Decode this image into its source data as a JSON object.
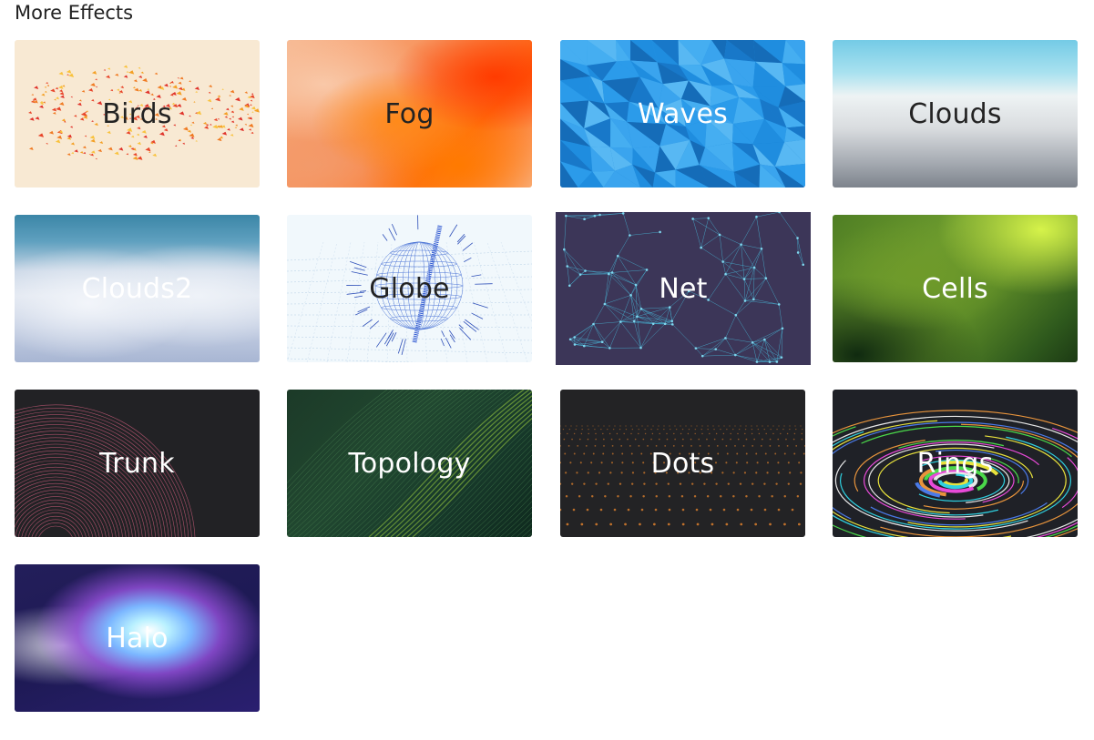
{
  "section_title": "More Effects",
  "effects": [
    {
      "label": "Birds"
    },
    {
      "label": "Fog"
    },
    {
      "label": "Waves"
    },
    {
      "label": "Clouds"
    },
    {
      "label": "Clouds2"
    },
    {
      "label": "Globe"
    },
    {
      "label": "Net"
    },
    {
      "label": "Cells"
    },
    {
      "label": "Trunk"
    },
    {
      "label": "Topology"
    },
    {
      "label": "Dots"
    },
    {
      "label": "Rings"
    },
    {
      "label": "Halo"
    }
  ]
}
